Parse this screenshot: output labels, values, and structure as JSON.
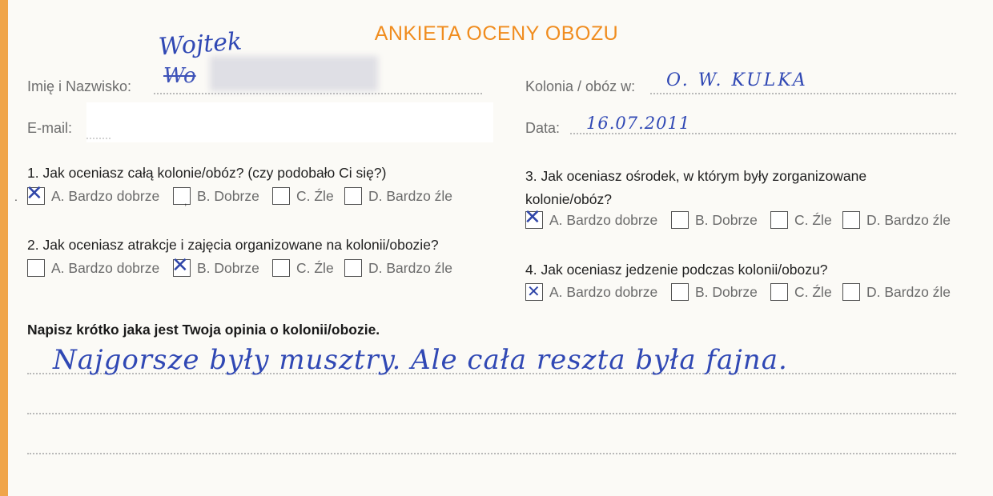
{
  "form": {
    "title": "ANKIETA OCENY OBOZU",
    "fields": {
      "name_label": "Imię i Nazwisko:",
      "name_value": "Wojtek",
      "email_label": "E-mail:",
      "camp_label": "Kolonia / obóz w:",
      "camp_value": "O. W. KULKA",
      "date_label": "Data:",
      "date_value": "16.07.2011"
    },
    "questions": [
      {
        "number": "1.",
        "text": "Jak oceniasz całą kolonie/obóz? (czy podobało Ci się?)",
        "text_line2": "",
        "options": [
          "A. Bardzo dobrze",
          "B. Dobrze",
          "C. Źle",
          "D. Bardzo źle"
        ],
        "selected": "A. Bardzo dobrze"
      },
      {
        "number": "2.",
        "text": "Jak oceniasz atrakcje i zajęcia organizowane na kolonii/obozie?",
        "text_line2": "",
        "options": [
          "A. Bardzo dobrze",
          "B. Dobrze",
          "C. Źle",
          "D. Bardzo źle"
        ],
        "selected": "B. Dobrze"
      },
      {
        "number": "3.",
        "text": "Jak oceniasz ośrodek, w którym były zorganizowane",
        "text_line2": "kolonie/obóz?",
        "options": [
          "A. Bardzo dobrze",
          "B. Dobrze",
          "C. Źle",
          "D. Bardzo źle"
        ],
        "selected": "A. Bardzo dobrze"
      },
      {
        "number": "4.",
        "text": "Jak oceniasz jedzenie podczas kolonii/obozu?",
        "text_line2": "",
        "options": [
          "A. Bardzo dobrze",
          "B. Dobrze",
          "C. Źle",
          "D. Bardzo źle"
        ],
        "selected": "A. Bardzo dobrze"
      }
    ],
    "opinion": {
      "prompt": "Napisz krótko jaka jest Twoja opinia o kolonii/obozie.",
      "answer": "Najgorsze były musztry. Ale cała reszta była fajna."
    },
    "colors": {
      "accent": "#f08c1e",
      "ink": "#3048b4"
    }
  }
}
